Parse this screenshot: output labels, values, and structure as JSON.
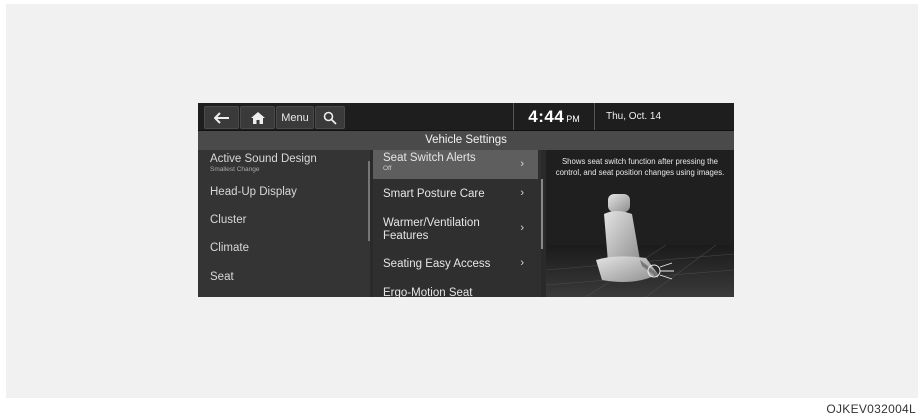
{
  "topbar": {
    "back_icon": "arrow-left-icon",
    "home_icon": "home-icon",
    "menu_label": "Menu",
    "search_icon": "search-icon",
    "time": "4:44",
    "ampm": "PM",
    "date": "Thu, Oct. 14"
  },
  "title": "Vehicle Settings",
  "left_menu": {
    "items": [
      {
        "label": "Active Sound Design",
        "sub": "Smallest Change"
      },
      {
        "label": "Head-Up Display"
      },
      {
        "label": "Cluster"
      },
      {
        "label": "Climate"
      },
      {
        "label": "Seat"
      }
    ]
  },
  "mid_menu": {
    "items": [
      {
        "label": "Seat Switch Alerts",
        "sub": "Off",
        "selected": true
      },
      {
        "label": "Smart Posture Care"
      },
      {
        "label": "Warmer/Ventilation",
        "label2": "Features"
      },
      {
        "label": "Seating Easy Access"
      },
      {
        "label": "Ergo-Motion Seat"
      }
    ],
    "chevron": "chevron-right-icon"
  },
  "info_panel": {
    "description": "Shows seat switch function after pressing the control, and seat position changes using images.",
    "image": "car-seat-image"
  },
  "caption": "OJKEV032004L",
  "colors": {
    "screen_bg": "#2a2a2a",
    "title_bar": "#4a4a4a",
    "selected_row": "#5e5e5e",
    "text": "#e6e6e6"
  }
}
